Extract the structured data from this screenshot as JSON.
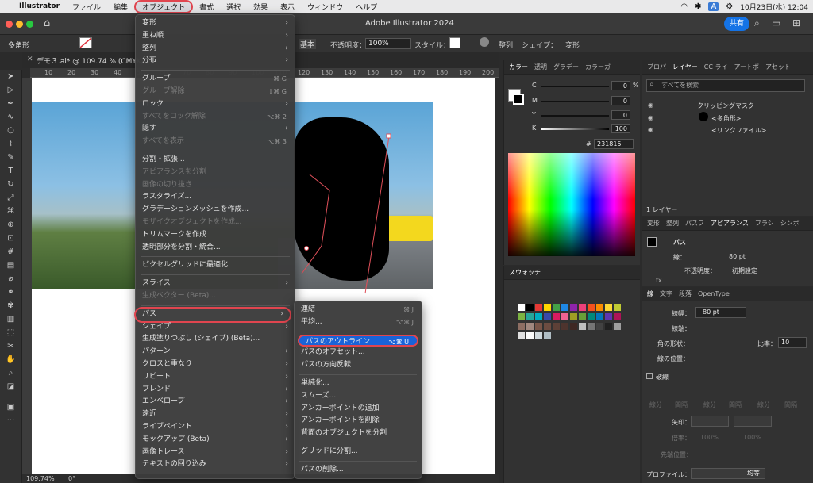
{
  "menubar": {
    "apple": "",
    "app": "Illustrator",
    "items": [
      "ファイル",
      "編集",
      "オブジェクト",
      "書式",
      "選択",
      "効果",
      "表示",
      "ウィンドウ",
      "ヘルプ"
    ],
    "right": {
      "date": "10月23日(水) 12:04",
      "input": "A"
    }
  },
  "titlebar": {
    "title": "Adobe Illustrator 2024",
    "share": "共有"
  },
  "control": {
    "object": "多角形",
    "basic": "基本",
    "opacity_label": "不透明度：",
    "opacity": "100%",
    "style_label": "スタイル：",
    "align": "整列",
    "shape": "シェイプ：",
    "transform": "変形"
  },
  "document_tab": "デモ３.ai* @ 109.74 % (CMYK/...",
  "ruler": [
    "10",
    "20",
    "30",
    "40",
    "50",
    "60",
    "70",
    "80",
    "90",
    "100",
    "110",
    "120",
    "130",
    "140",
    "150",
    "160",
    "170",
    "180",
    "190",
    "200"
  ],
  "status": {
    "zoom": "109.74%",
    "angle": "0°"
  },
  "object_menu": {
    "items": [
      {
        "label": "変形",
        "arrow": true
      },
      {
        "label": "重ね順",
        "arrow": true
      },
      {
        "label": "整列",
        "arrow": true
      },
      {
        "label": "分布",
        "arrow": true
      },
      {
        "sep": true
      },
      {
        "label": "グループ",
        "sc": "⌘ G"
      },
      {
        "label": "グループ解除",
        "sc": "⇧⌘ G",
        "dis": true
      },
      {
        "label": "ロック",
        "arrow": true
      },
      {
        "label": "すべてをロック解除",
        "sc": "⌥⌘ 2",
        "dis": true
      },
      {
        "label": "隠す",
        "arrow": true
      },
      {
        "label": "すべてを表示",
        "sc": "⌥⌘ 3",
        "dis": true
      },
      {
        "sep": true
      },
      {
        "label": "分割・拡張..."
      },
      {
        "label": "アピアランスを分割",
        "dis": true
      },
      {
        "label": "画像の切り抜き",
        "dis": true
      },
      {
        "label": "ラスタライズ..."
      },
      {
        "label": "グラデーションメッシュを作成..."
      },
      {
        "label": "モザイクオブジェクトを作成...",
        "dis": true
      },
      {
        "label": "トリムマークを作成"
      },
      {
        "label": "透明部分を分割・統合..."
      },
      {
        "sep": true
      },
      {
        "label": "ピクセルグリッドに最適化"
      },
      {
        "sep": true
      },
      {
        "label": "スライス",
        "arrow": true
      },
      {
        "label": "生成ベクター (Beta)...",
        "dis": true
      },
      {
        "sep": true
      },
      {
        "label": "パス",
        "arrow": true,
        "hl": true
      },
      {
        "label": "シェイプ",
        "arrow": true
      },
      {
        "label": "生成塗りつぶし (シェイプ) (Beta)..."
      },
      {
        "label": "パターン",
        "arrow": true
      },
      {
        "label": "クロスと重なり",
        "arrow": true
      },
      {
        "label": "リピート",
        "arrow": true
      },
      {
        "label": "ブレンド",
        "arrow": true
      },
      {
        "label": "エンベロープ",
        "arrow": true
      },
      {
        "label": "遠近",
        "arrow": true
      },
      {
        "label": "ライブペイント",
        "arrow": true
      },
      {
        "label": "モックアップ (Beta)",
        "arrow": true
      },
      {
        "label": "画像トレース",
        "arrow": true
      },
      {
        "label": "テキストの回り込み",
        "arrow": true
      }
    ]
  },
  "path_menu": {
    "items": [
      {
        "label": "連結",
        "sc": "⌘ J"
      },
      {
        "label": "平均...",
        "sc": "⌥⌘ J"
      },
      {
        "sep": true
      },
      {
        "label": "パスのアウトライン",
        "sc": "⌥⌘ U",
        "sel": true
      },
      {
        "label": "パスのオフセット..."
      },
      {
        "label": "パスの方向反転"
      },
      {
        "sep": true
      },
      {
        "label": "単純化..."
      },
      {
        "label": "スムーズ..."
      },
      {
        "label": "アンカーポイントの追加"
      },
      {
        "label": "アンカーポイントを削除"
      },
      {
        "label": "背面のオブジェクトを分割"
      },
      {
        "sep": true
      },
      {
        "label": "グリッドに分割..."
      },
      {
        "sep": true
      },
      {
        "label": "パスの削除..."
      }
    ]
  },
  "color_panel": {
    "tabs": [
      "カラー",
      "透明",
      "グラデー",
      "カラーガ"
    ],
    "channels": [
      {
        "k": "C",
        "v": "0"
      },
      {
        "k": "M",
        "v": "0"
      },
      {
        "k": "Y",
        "v": "0"
      },
      {
        "k": "K",
        "v": "100"
      }
    ],
    "pct": "%",
    "hex_label": "#",
    "hex": "231815"
  },
  "swatch_panel": {
    "title": "スウォッチ"
  },
  "layers_panel": {
    "tabs": [
      "プロパ",
      "レイヤー",
      "CC ライ",
      "アートボ",
      "アセット"
    ],
    "search": "すべてを検索",
    "rows": [
      "クリッピングマスク",
      "<多角形>",
      "<リンクファイル>"
    ],
    "count": "1 レイヤー"
  },
  "appearance_panel": {
    "tabs": [
      "変形",
      "整列",
      "パスフ",
      "アピアランス",
      "ブラシ",
      "シンボ"
    ],
    "title": "パス",
    "stroke_label": "線：",
    "stroke": "80 pt",
    "opacity_label": "不透明度：",
    "opacity": "初期設定",
    "fx": "fx."
  },
  "stroke_panel": {
    "tabs": [
      "線",
      "文字",
      "段落",
      "OpenType"
    ],
    "width_label": "線幅：",
    "width": "80 pt",
    "cap_label": "線端：",
    "corner_label": "角の形状：",
    "limit_label": "比率：",
    "limit": "10",
    "align_label": "線の位置：",
    "dashed": "破線",
    "dash_labels": [
      "線分",
      "間隔",
      "線分",
      "間隔",
      "線分",
      "間隔"
    ],
    "arrow_label": "矢印：",
    "scale_label": "倍率：",
    "scale1": "100%",
    "scale2": "100%",
    "tip_label": "先端位置：",
    "profile_label": "プロファイル：",
    "profile": "均等"
  }
}
